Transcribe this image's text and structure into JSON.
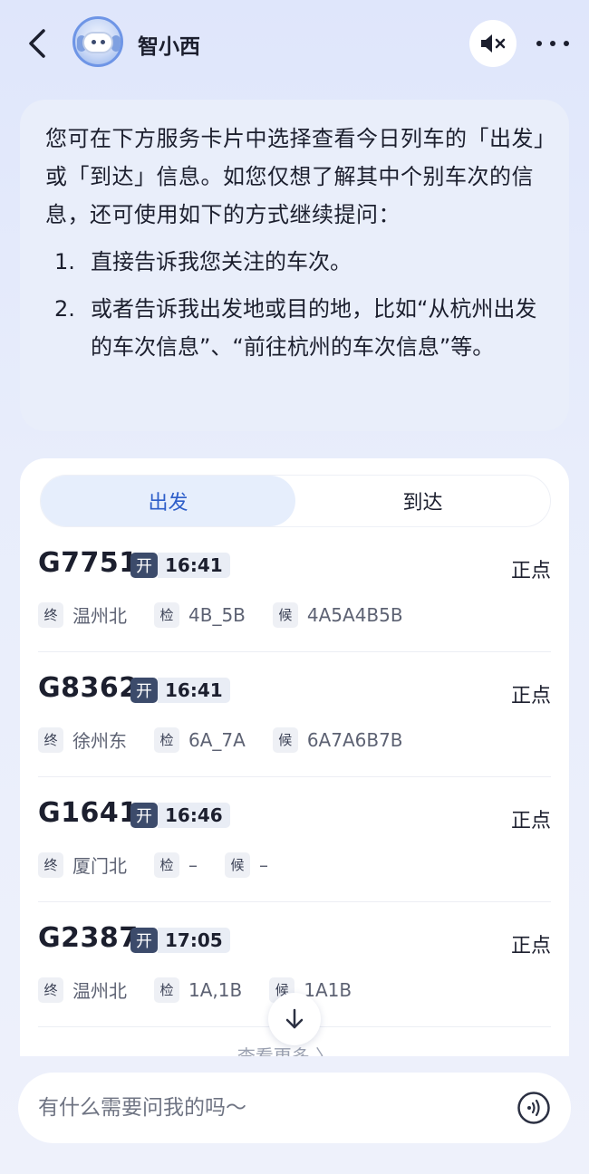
{
  "header": {
    "bot_name": "智小西"
  },
  "message": {
    "intro": "您可在下方服务卡片中选择查看今日列车的「出发」或「到达」信息。如您仅想了解其中个别车次的信息，还可使用如下的方式继续提问：",
    "items": [
      {
        "num": "1.",
        "text": "直接告诉我您关注的车次。"
      },
      {
        "num": "2.",
        "text": "或者告诉我出发地或目的地，比如“从杭州出发的车次信息”、“前往杭州的车次信息”等。"
      }
    ]
  },
  "card": {
    "tabs": [
      {
        "label": "出发",
        "active": true
      },
      {
        "label": "到达",
        "active": false
      }
    ],
    "labels": {
      "depart_tag": "开",
      "terminal_tag": "终",
      "check_tag": "检",
      "wait_tag": "候"
    },
    "trains": [
      {
        "code": "G7751",
        "time": "16:41",
        "status": "正点",
        "terminal": "温州北",
        "check": "4B_5B",
        "wait": "4A5A4B5B"
      },
      {
        "code": "G8362",
        "time": "16:41",
        "status": "正点",
        "terminal": "徐州东",
        "check": "6A_7A",
        "wait": "6A7A6B7B"
      },
      {
        "code": "G1641",
        "time": "16:46",
        "status": "正点",
        "terminal": "厦门北",
        "check": "–",
        "wait": "–"
      },
      {
        "code": "G2387",
        "time": "17:05",
        "status": "正点",
        "terminal": "温州北",
        "check": "1A,1B",
        "wait": "1A1B"
      }
    ],
    "view_more": "查看更多 〉"
  },
  "input": {
    "placeholder": "有什么需要问我的吗～"
  },
  "icons": {
    "back": "chevron-left-icon",
    "mute": "speaker-mute-icon",
    "more": "more-dots-icon",
    "scroll_down": "arrow-down-icon",
    "voice": "voice-wave-icon"
  },
  "colors": {
    "accent": "#2e5ec9",
    "depart_tag_bg": "#3c4b6b"
  }
}
